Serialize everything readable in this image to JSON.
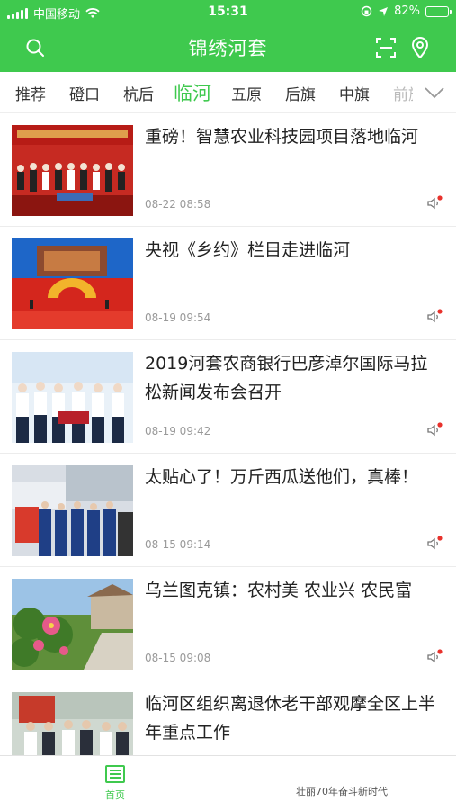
{
  "status_bar": {
    "carrier": "中国移动",
    "time": "15:31",
    "battery": "82%",
    "battery_level": 0.82
  },
  "header": {
    "title": "锦绣河套",
    "search_icon": "search-icon",
    "scan_icon": "scan-icon",
    "location_icon": "location-pin-icon"
  },
  "tabs": {
    "items": [
      "推荐",
      "磴口",
      "杭后",
      "临河",
      "五原",
      "后旗",
      "中旗",
      "前旗"
    ],
    "active": "临河",
    "more_icon": "chevron-down-icon"
  },
  "news": [
    {
      "title": "重磅！智慧农业科技园项目落地临河",
      "date": "08-22 08:58"
    },
    {
      "title": "央视《乡约》栏目走进临河",
      "date": "08-19 09:54"
    },
    {
      "title": "2019河套农商银行巴彦淖尔国际马拉松新闻发布会召开",
      "date": "08-19 09:42"
    },
    {
      "title": "太贴心了！万斤西瓜送他们，真棒！",
      "date": "08-15 09:14"
    },
    {
      "title": "乌兰图克镇：农村美 农业兴 农民富",
      "date": "08-15 09:08"
    },
    {
      "title": "临河区组织离退休老干部观摩全区上半年重点工作",
      "date": ""
    }
  ],
  "tabbar": {
    "home_label": "首页",
    "other_label": "壮丽70年奋斗新时代"
  },
  "colors": {
    "brand": "#3fc94e",
    "accent_dot": "#e8322c"
  }
}
